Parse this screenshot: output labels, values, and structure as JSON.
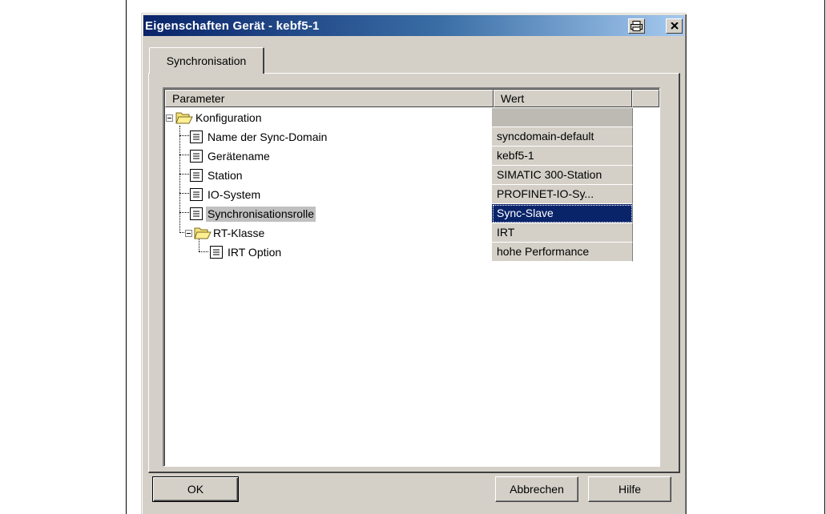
{
  "window": {
    "title": "Eigenschaften Gerät - kebf5-1",
    "print_icon": "printer-icon",
    "close_icon": "close-icon"
  },
  "tabs": [
    {
      "label": "Synchronisation",
      "active": true
    }
  ],
  "table": {
    "columns": [
      "Parameter",
      "Wert"
    ],
    "rows": [
      {
        "label": "Konfiguration",
        "value": "",
        "type": "folder",
        "level": 0
      },
      {
        "label": "Name der Sync-Domain",
        "value": "syncdomain-default",
        "type": "item",
        "level": 1
      },
      {
        "label": "Gerätename",
        "value": "kebf5-1",
        "type": "item",
        "level": 1
      },
      {
        "label": "Station",
        "value": "SIMATIC 300-Station",
        "type": "item",
        "level": 1
      },
      {
        "label": "IO-System",
        "value": "PROFINET-IO-Sy...",
        "type": "item",
        "level": 1
      },
      {
        "label": "Synchronisationsrolle",
        "value": "Sync-Slave",
        "type": "item",
        "level": 1,
        "selected": true
      },
      {
        "label": "RT-Klasse",
        "value": "IRT",
        "type": "folder",
        "level": 1
      },
      {
        "label": "IRT Option",
        "value": "hohe Performance",
        "type": "item",
        "level": 2
      }
    ]
  },
  "buttons": {
    "ok": "OK",
    "cancel": "Abbrechen",
    "help": "Hilfe"
  },
  "colors": {
    "titlebar_start": "#0a246a",
    "titlebar_end": "#a6caf0",
    "selection": "#0a246a",
    "dialog_bg": "#d4d0c8"
  }
}
